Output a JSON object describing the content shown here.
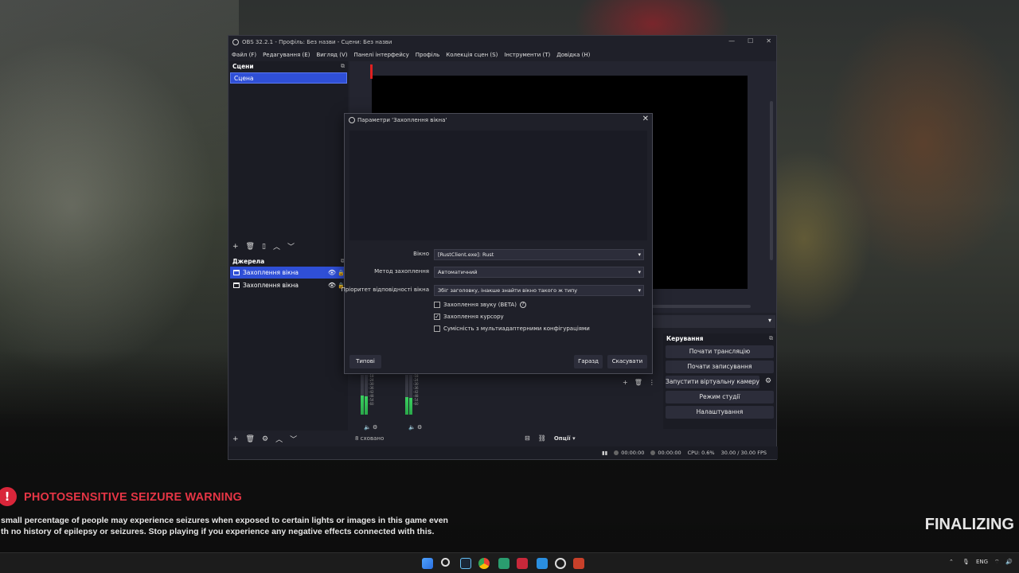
{
  "obs": {
    "title": "OBS 32.2.1 - Профіль: Без назви - Сцени: Без назви",
    "window_controls": {
      "min": "—",
      "max": "☐",
      "close": "✕"
    },
    "menu": [
      "Файл (F)",
      "Редагування (E)",
      "Вигляд (V)",
      "Панелі інтерфейсу",
      "Профіль",
      "Колекція сцен (S)",
      "Інструменти (T)",
      "Довідка (H)"
    ],
    "scenes": {
      "header": "Сцени",
      "items": [
        "Сцена"
      ]
    },
    "sources": {
      "header": "Джерела",
      "items": [
        "Захоплення вікна",
        "Захоплення вікна"
      ]
    },
    "controls": {
      "header": "Керування",
      "start_stream": "Почати трансляцію",
      "start_record": "Почати записування",
      "virtual_cam": "Запустити віртуальну камеру",
      "studio_mode": "Режим студії",
      "settings": "Налаштування"
    },
    "mixer": {
      "hidden_count": "8 сховано",
      "options": "Опції",
      "scale": [
        "-12",
        "-18",
        "-24",
        "-30",
        "-36",
        "-42",
        "-48",
        "-54",
        "-60"
      ],
      "levels": [
        0.48,
        0.46,
        0.44,
        0.42
      ]
    },
    "status": {
      "time1": "00:00:00",
      "time2": "00:00:00",
      "cpu": "CPU: 0.6%",
      "fps": "30.00 / 30.00 FPS"
    }
  },
  "dialog": {
    "title": "Параметри 'Захоплення вікна'",
    "window_label": "Вікно",
    "window_value": "[RustClient.exe]: Rust",
    "method_label": "Метод захоплення",
    "method_value": "Автоматичний",
    "priority_label": "Пріоритет відповідності вікна",
    "priority_value": "Збіг заголовку, інакше знайти вікно такого ж типу",
    "checkboxes": [
      {
        "label": "Захоплення звуку (BETA)",
        "checked": false,
        "help": true
      },
      {
        "label": "Захоплення курсору",
        "checked": true
      },
      {
        "label": "Сумісність з мультиадаптерними конфігураціями",
        "checked": false
      }
    ],
    "defaults_button": "Типові",
    "ok_button": "Гаразд",
    "cancel_button": "Скасувати"
  },
  "warning": {
    "icon": "!",
    "title": "PHOTOSENSITIVE SEIZURE WARNING",
    "line1": "small percentage of people may experience seizures when exposed to certain lights or images in this game even",
    "line2": "th no history of epilepsy or seizures. Stop playing if you experience any negative effects connected with this."
  },
  "finalizing": "FINALIZING",
  "taskbar": {
    "lang": "ENG",
    "icons": [
      "windows-start",
      "search",
      "steam",
      "chrome",
      "discord",
      "app-red",
      "app-blue",
      "obs",
      "app-rust"
    ]
  },
  "colors": {
    "accent": "#2f4fd6",
    "warning_red": "#e53545"
  }
}
